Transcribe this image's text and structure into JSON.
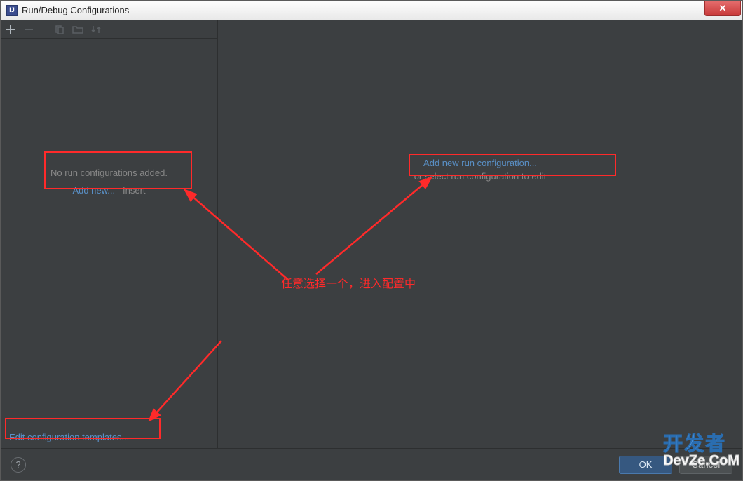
{
  "window": {
    "title": "Run/Debug Configurations"
  },
  "toolbar": {
    "add_tooltip": "Add",
    "remove_tooltip": "Remove",
    "copy_tooltip": "Copy",
    "folder_tooltip": "Folder",
    "sort_tooltip": "Sort"
  },
  "left": {
    "empty_text": "No run configurations added.",
    "add_new_link": "Add new...",
    "add_new_shortcut": "Insert",
    "edit_templates": "Edit configuration templates..."
  },
  "right": {
    "add_new_link": "Add new run configuration...",
    "or_select_text": "or select run configuration to edit"
  },
  "footer": {
    "ok": "OK",
    "cancel": "Cancel"
  },
  "annotation": {
    "center_text": "任意选择一个，进入配置中"
  },
  "watermark": {
    "cn": "开发者",
    "en": "DevZe.CoM"
  }
}
